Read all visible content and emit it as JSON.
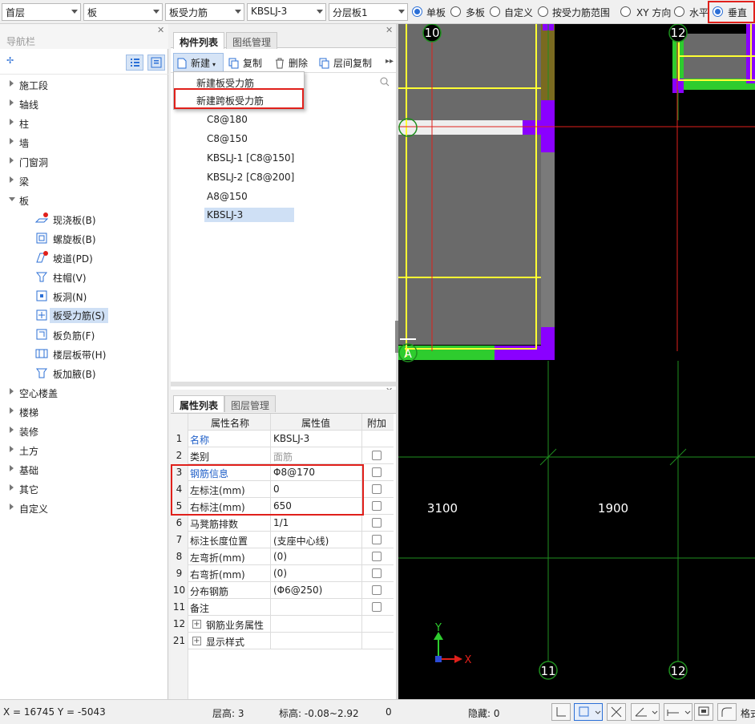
{
  "toolbar": {
    "floor": "首层",
    "category": "板",
    "type": "板受力筋",
    "component": "KBSLJ-3",
    "layer": "分层板1",
    "radios": [
      {
        "label": "单板",
        "checked": true
      },
      {
        "label": "多板",
        "checked": false
      },
      {
        "label": "自定义",
        "checked": false
      },
      {
        "label": "按受力筋范围",
        "checked": false
      },
      {
        "label": "XY 方向",
        "checked": false
      },
      {
        "label": "水平",
        "checked": false
      },
      {
        "label": "垂直",
        "checked": true
      }
    ]
  },
  "nav": {
    "title": "导航栏",
    "items": [
      {
        "label": "施工段"
      },
      {
        "label": "轴线"
      },
      {
        "label": "柱"
      },
      {
        "label": "墙"
      },
      {
        "label": "门窗洞"
      },
      {
        "label": "梁"
      },
      {
        "label": "板"
      }
    ],
    "sub_items": [
      {
        "label": "现浇板(B)"
      },
      {
        "label": "螺旋板(B)"
      },
      {
        "label": "坡道(PD)"
      },
      {
        "label": "柱帽(V)"
      },
      {
        "label": "板洞(N)"
      },
      {
        "label": "板受力筋(S)"
      },
      {
        "label": "板负筋(F)"
      },
      {
        "label": "楼层板带(H)"
      },
      {
        "label": "板加腋(B)"
      }
    ],
    "items_after": [
      {
        "label": "空心楼盖"
      },
      {
        "label": "楼梯"
      },
      {
        "label": "装修"
      },
      {
        "label": "土方"
      },
      {
        "label": "基础"
      },
      {
        "label": "其它"
      },
      {
        "label": "自定义"
      }
    ]
  },
  "components_panel": {
    "tabs": [
      "构件列表",
      "图纸管理"
    ],
    "buttons": {
      "new": "新建",
      "copy": "复制",
      "delete": "删除",
      "layer_copy": "层间复制"
    },
    "menu": [
      "新建板受力筋",
      "新建跨板受力筋"
    ],
    "list": [
      "C8@180",
      "C8@150",
      "KBSLJ-1 [C8@150]",
      "KBSLJ-2 [C8@200]",
      "A8@150",
      "KBSLJ-3"
    ]
  },
  "props_panel": {
    "tabs": [
      "属性列表",
      "图层管理"
    ],
    "headers": [
      "属性名称",
      "属性值",
      "附加"
    ],
    "rows": [
      {
        "n": "1",
        "name": "名称",
        "value": "KBSLJ-3"
      },
      {
        "n": "2",
        "name": "类别",
        "value": "面筋"
      },
      {
        "n": "3",
        "name": "钢筋信息",
        "value": "Φ8@170"
      },
      {
        "n": "4",
        "name": "左标注(mm)",
        "value": "0"
      },
      {
        "n": "5",
        "name": "右标注(mm)",
        "value": "650"
      },
      {
        "n": "6",
        "name": "马凳筋排数",
        "value": "1/1"
      },
      {
        "n": "7",
        "name": "标注长度位置",
        "value": "(支座中心线)"
      },
      {
        "n": "8",
        "name": "左弯折(mm)",
        "value": "(0)"
      },
      {
        "n": "9",
        "name": "右弯折(mm)",
        "value": "(0)"
      },
      {
        "n": "10",
        "name": "分布钢筋",
        "value": "(Φ6@250)"
      },
      {
        "n": "11",
        "name": "备注",
        "value": ""
      },
      {
        "n": "12",
        "name": "钢筋业务属性",
        "value": ""
      },
      {
        "n": "21",
        "name": "显示样式",
        "value": ""
      }
    ]
  },
  "canvas": {
    "axis_labels": [
      "10",
      "12",
      "11",
      "12",
      "A"
    ],
    "dims": [
      "3100",
      "1900"
    ],
    "x_axis": "X",
    "y_axis": "Y"
  },
  "status": {
    "coords": "X = 16745 Y = -5043",
    "floor_height": "层高:  3",
    "elevation": "标高:  -0.08~2.92",
    "zero": "0",
    "hidden": "隐藏:  0",
    "format": "格式"
  },
  "colors": {
    "accent": "#2b6fd6",
    "highlight": "#e0201b",
    "selection": "#cfe0f5"
  }
}
